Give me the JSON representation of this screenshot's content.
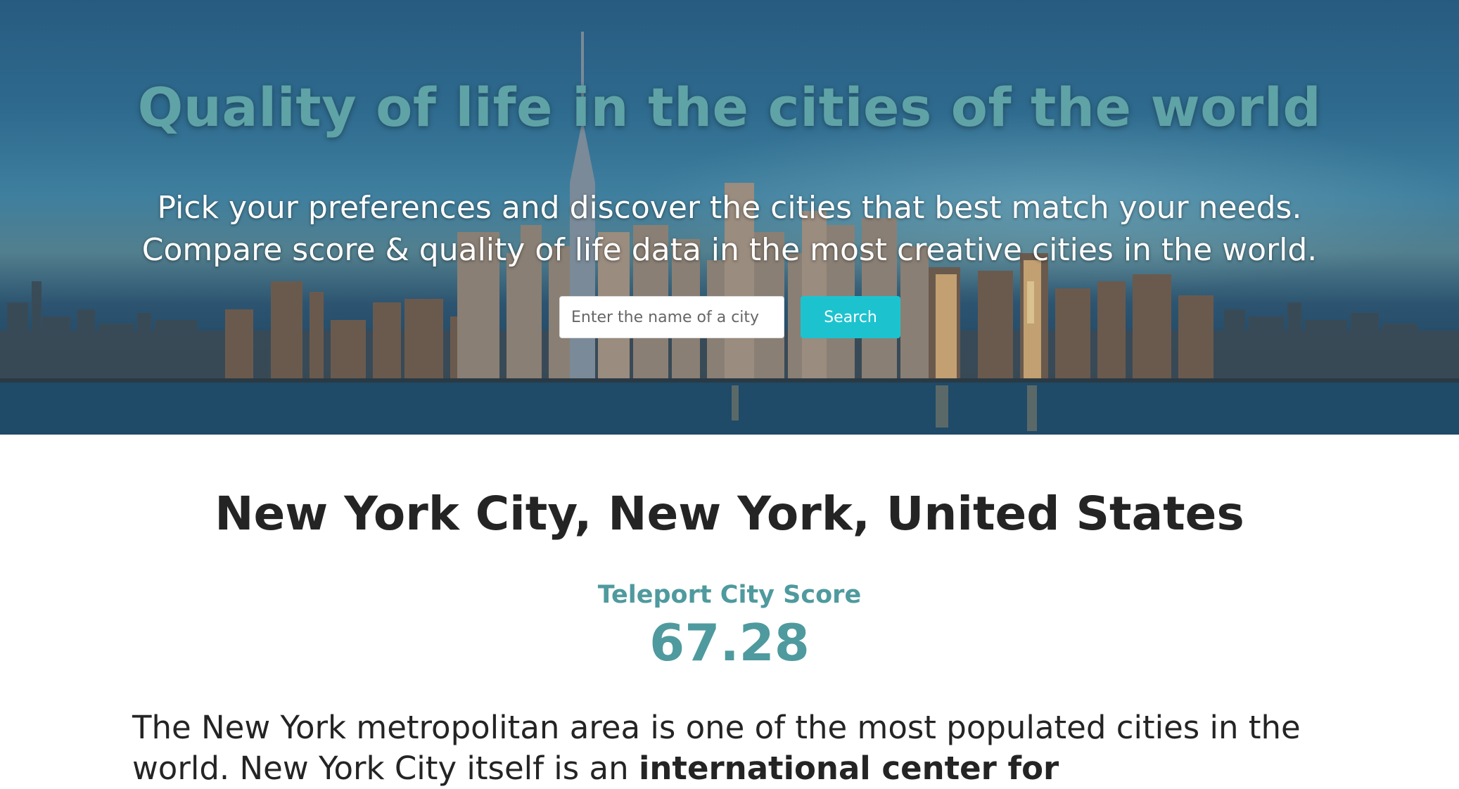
{
  "hero": {
    "title": "Quality of life in the cities of the world",
    "subtitle_line1": "Pick your preferences and discover the cities that best match your needs.",
    "subtitle_line2": "Compare score & quality of life data in the most creative cities in the world.",
    "background_image": "new-york-skyline-photo"
  },
  "search": {
    "placeholder": "Enter the name of a city",
    "value": "",
    "button_label": "Search",
    "button_color": "#1cc3cf"
  },
  "city": {
    "name": "New York City, New York, United States",
    "score_label": "Teleport City Score",
    "score_value": "67.28",
    "accent_color": "#4f9a9e",
    "description_start": "The New York metropolitan area is one of the most populated cities in the world. New York City itself is an ",
    "description_bold": "international center for"
  }
}
